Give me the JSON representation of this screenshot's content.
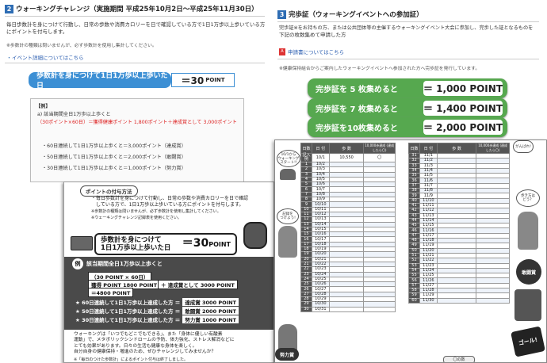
{
  "left": {
    "section_number": "2",
    "section_title": "ウォーキングチャレンジ（実施期間 平成25年10月2日～平成25年11月30日）",
    "intro_lines": [
      "毎日歩数計を身につけて行動し、日常の歩数や消費カロリーを日で確認している方で1日1万歩以上歩いている方",
      "にポイントを付与します。"
    ],
    "note": "※歩数計の種類は問いませんが、必ず歩数計を使用し集計してください。",
    "link_text": "イベント詳細についてはこちら",
    "banner_label": "歩数計を身につけて1日1万歩以上歩いた日",
    "banner_points": "＝30",
    "banner_unit": "POINT",
    "example": {
      "tag": "【例】",
      "lines": [
        "a) 該当期間全日1万歩以上歩くと",
        "（30ポイント×60日）＝獲得健康ポイント 1,800ポイント＋達成賞として 3,000ポイント",
        "・60日連続して1日1万歩以上歩くと＝3,000ポイント（達成賞）",
        "・50日連続して1日1万歩以上歩くと＝2,000ポイント（敢闘賞）",
        "・30日連続して1日1万歩以上歩くと＝1,000ポイント（努力賞）"
      ]
    }
  },
  "right": {
    "section_number": "3",
    "section_title": "完歩証（ウォーキングイベントへの参加証）",
    "intro_lines": [
      "完歩証※をお持ちの方、または公共団体等の主催するウォーキングイベント大会に参加し、完歩した証となるものを",
      "下記の枚数集めて申請した方"
    ],
    "link_text": "申請書についてはこちら",
    "note": "※健康保持組合からご案内したウォーキングイベントへ参加された方へ完歩証を発行しています。",
    "awards": [
      {
        "label": "完歩証を 5 枚集めると",
        "points": "＝ 1,000 POINT"
      },
      {
        "label": "完歩証を 7 枚集めると",
        "points": "＝ 1,400 POINT"
      },
      {
        "label": "完歩証を10枚集めると",
        "points": "＝ 2,000 POINT"
      }
    ]
  },
  "flyer": {
    "tag": "ポイントの付与方法",
    "lines": [
      "・毎日歩数計を身につけて行動し、日常の歩数や消費カロリーを日で確認",
      "　している方で、1日1万歩以上歩いている方にポイントを付与します。",
      "※歩数計の種類は問いませんが、必ず歩数計を使用し集計してください。",
      "※ウェーキングチャレンジ記録表を使用ください。"
    ],
    "banner_line1": "歩数計を身につけて",
    "banner_line2": "1日1万歩以上歩いた日",
    "banner_points": "＝30",
    "banner_unit": "POINT",
    "example_tag": "例",
    "example_title": "該当期間全日1万歩以上歩くと",
    "calc": "（30 POINT × 60日）",
    "calc_get": "獲得 POINT 1800 POINT",
    "calc_plus": "＋ 達成賞として 3000 POINT",
    "calc_total": "＝4800 POINT",
    "rows": [
      {
        "label": "★ 60日連続して1日1万歩以上達成した方 ＝",
        "value": "達成賞 3000 POINT"
      },
      {
        "label": "★ 50日連続して1日1万歩以上達成した方 ＝",
        "value": "敢闘賞 2000 POINT"
      },
      {
        "label": "★ 30日連続して1日1万歩以上達成した方 ＝",
        "value": "努力賞 1000 POINT"
      }
    ],
    "bottom_lines": [
      "ウォーキングは「いつでもどこでもできる」、また「身体に優しい有酸素",
      "運動」で、メタボリックシンドロームの予防、体力強化、ストレス解消などに",
      "とても効果があります。日々の生活も健康な身体を楽しく。",
      "自分自身の健康保持・増進のため、ぜひチャレンジしてみませんか？"
    ],
    "footer_note": "※「毎日のつけた歩数計」によるポイント付与は終了しました。"
  },
  "sheet": {
    "headers": [
      "日数",
      "日 付",
      "歩 数",
      "10,000歩達成\n(達成したら〇)"
    ],
    "first_col_rows": [
      {
        "day": "記入例",
        "date": "10/1",
        "steps": "10,550",
        "mark": "〇"
      },
      {
        "day": "1",
        "date": "10/2"
      },
      {
        "day": "2",
        "date": "10/3"
      },
      {
        "day": "3",
        "date": "10/4"
      },
      {
        "day": "4",
        "date": "10/5"
      },
      {
        "day": "5",
        "date": "10/6"
      },
      {
        "day": "6",
        "date": "10/7"
      },
      {
        "day": "7",
        "date": "10/8"
      },
      {
        "day": "8",
        "date": "10/9"
      },
      {
        "day": "9",
        "date": "10/10"
      },
      {
        "day": "10",
        "date": "10/11"
      },
      {
        "day": "11",
        "date": "10/12"
      },
      {
        "day": "12",
        "date": "10/13"
      },
      {
        "day": "13",
        "date": "10/14"
      },
      {
        "day": "14",
        "date": "10/15"
      },
      {
        "day": "15",
        "date": "10/16"
      },
      {
        "day": "16",
        "date": "10/17"
      },
      {
        "day": "17",
        "date": "10/18"
      },
      {
        "day": "18",
        "date": "10/19"
      },
      {
        "day": "19",
        "date": "10/20"
      },
      {
        "day": "20",
        "date": "10/21"
      },
      {
        "day": "21",
        "date": "10/22"
      },
      {
        "day": "22",
        "date": "10/23"
      },
      {
        "day": "23",
        "date": "10/24"
      },
      {
        "day": "24",
        "date": "10/25"
      },
      {
        "day": "25",
        "date": "10/26"
      },
      {
        "day": "26",
        "date": "10/27"
      },
      {
        "day": "27",
        "date": "10/28"
      },
      {
        "day": "28",
        "date": "10/29"
      },
      {
        "day": "29",
        "date": "10/30"
      },
      {
        "day": "30",
        "date": "10/31"
      }
    ],
    "second_col_rows": [
      {
        "day": "31",
        "date": "11/1"
      },
      {
        "day": "32",
        "date": "11/2"
      },
      {
        "day": "33",
        "date": "11/3"
      },
      {
        "day": "34",
        "date": "11/4"
      },
      {
        "day": "35",
        "date": "11/5"
      },
      {
        "day": "36",
        "date": "11/6"
      },
      {
        "day": "37",
        "date": "11/7"
      },
      {
        "day": "38",
        "date": "11/8"
      },
      {
        "day": "39",
        "date": "11/9"
      },
      {
        "day": "40",
        "date": "11/10"
      },
      {
        "day": "41",
        "date": "11/11"
      },
      {
        "day": "42",
        "date": "11/12"
      },
      {
        "day": "43",
        "date": "11/13"
      },
      {
        "day": "44",
        "date": "11/14"
      },
      {
        "day": "45",
        "date": "11/15"
      },
      {
        "day": "46",
        "date": "11/16"
      },
      {
        "day": "47",
        "date": "11/17"
      },
      {
        "day": "48",
        "date": "11/18"
      },
      {
        "day": "49",
        "date": "11/19"
      },
      {
        "day": "50",
        "date": "11/20"
      },
      {
        "day": "51",
        "date": "11/21"
      },
      {
        "day": "52",
        "date": "11/22"
      },
      {
        "day": "53",
        "date": "11/23"
      },
      {
        "day": "54",
        "date": "11/24"
      },
      {
        "day": "55",
        "date": "11/25"
      },
      {
        "day": "56",
        "date": "11/26"
      },
      {
        "day": "57",
        "date": "11/27"
      },
      {
        "day": "58",
        "date": "11/28"
      },
      {
        "day": "59",
        "date": "11/29"
      },
      {
        "day": "60",
        "date": "11/30"
      }
    ],
    "bubble_start": "10/1から\nウォーキング\nスタート!!",
    "bubble_mid": "記録を\nつけよう!",
    "bubble_right": "歩き方は\nどう？",
    "bubble_bottom": "がんばれ!",
    "award_badge": "努力賞",
    "award_badge2": "敢闘賞",
    "goal_label": "ゴール!",
    "footer_chip": "〇の数"
  },
  "colors": {
    "accent_blue": "#3c8fd4",
    "accent_green": "#56a84f",
    "dark_band": "#4a4a4a"
  }
}
